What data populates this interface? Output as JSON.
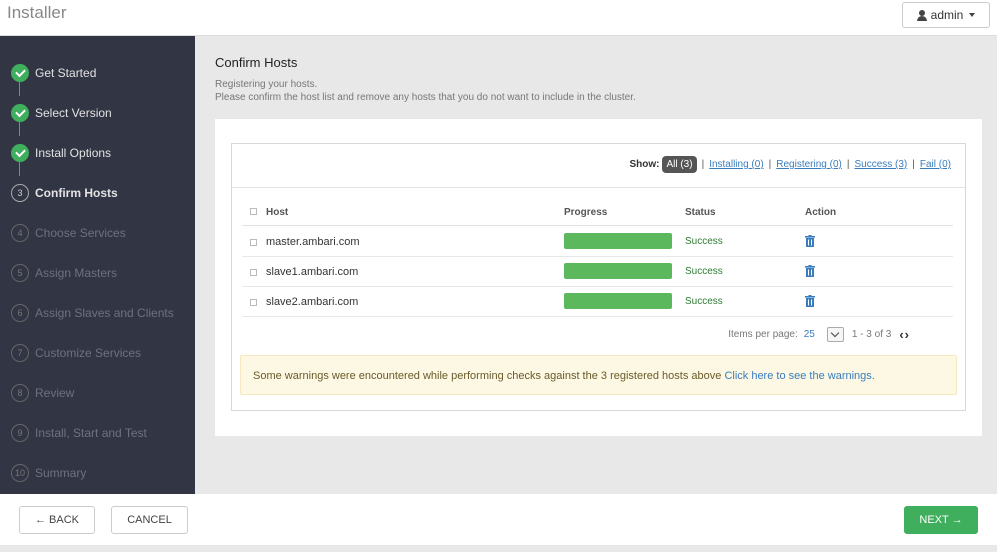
{
  "header": {
    "app_title": "Installer",
    "user_label": "admin"
  },
  "sidebar": {
    "steps": [
      {
        "number": "1",
        "label": "Get Started",
        "state": "done"
      },
      {
        "number": "2",
        "label": "Select Version",
        "state": "done"
      },
      {
        "number": "2",
        "label": "Install Options",
        "state": "done"
      },
      {
        "number": "3",
        "label": "Confirm Hosts",
        "state": "current"
      },
      {
        "number": "4",
        "label": "Choose Services",
        "state": "todo"
      },
      {
        "number": "5",
        "label": "Assign Masters",
        "state": "todo"
      },
      {
        "number": "6",
        "label": "Assign Slaves and Clients",
        "state": "todo"
      },
      {
        "number": "7",
        "label": "Customize Services",
        "state": "todo"
      },
      {
        "number": "8",
        "label": "Review",
        "state": "todo"
      },
      {
        "number": "9",
        "label": "Install, Start and Test",
        "state": "todo"
      },
      {
        "number": "10",
        "label": "Summary",
        "state": "todo"
      }
    ]
  },
  "main": {
    "title": "Confirm Hosts",
    "desc_line1": "Registering your hosts.",
    "desc_line2": "Please confirm the host list and remove any hosts that you do not want to include in the cluster.",
    "filters": {
      "show_label": "Show:",
      "all": "All (3)",
      "installing": "Installing (0)",
      "registering": "Registering (0)",
      "success": "Success (3)",
      "fail": "Fail (0)"
    },
    "table": {
      "headers": {
        "host": "Host",
        "progress": "Progress",
        "status": "Status",
        "action": "Action"
      },
      "rows": [
        {
          "host": "master.ambari.com",
          "progress": 1.0,
          "status": "Success"
        },
        {
          "host": "slave1.ambari.com",
          "progress": 1.0,
          "status": "Success"
        },
        {
          "host": "slave2.ambari.com",
          "progress": 1.0,
          "status": "Success"
        }
      ]
    },
    "pager": {
      "items_per_page_label": "Items per page:",
      "items_per_page": "25",
      "range": "1 - 3 of 3"
    },
    "warning": {
      "text": "Some warnings were encountered while performing checks against the 3 registered hosts above",
      "link": "Click here to see the warnings."
    }
  },
  "footer": {
    "back": "← BACK",
    "cancel": "CANCEL",
    "next": "NEXT →"
  },
  "colors": {
    "accent_green": "#3fae5d",
    "sidebar_bg": "#323544",
    "link_blue": "#3a7dbd"
  }
}
